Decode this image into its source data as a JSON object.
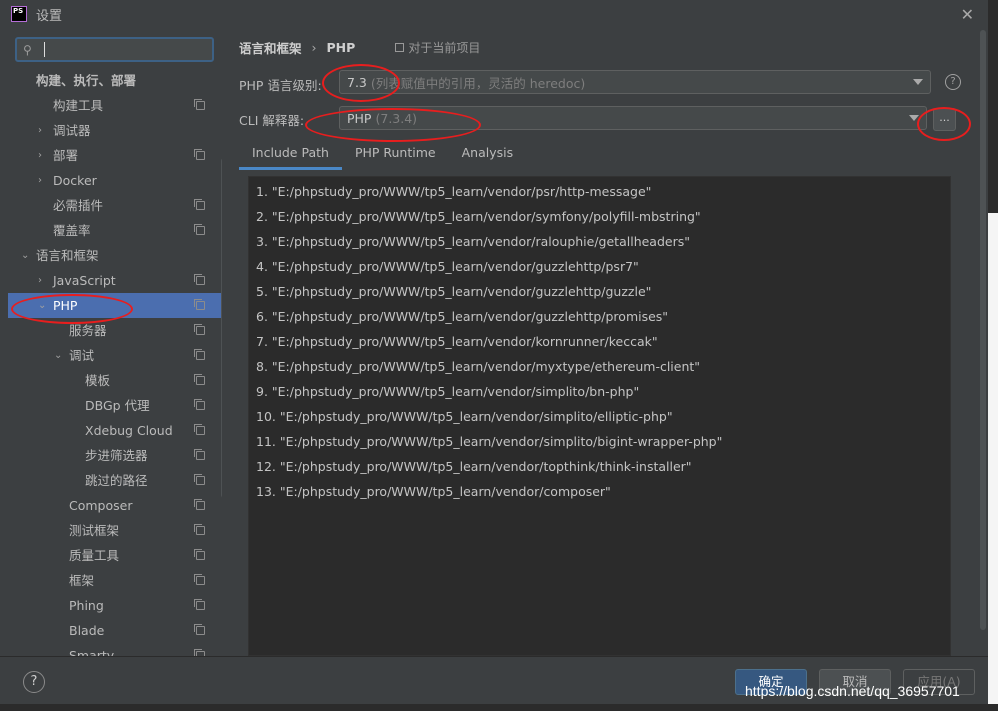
{
  "window": {
    "logo_text": "PS",
    "title": "设置",
    "close_glyph": "✕"
  },
  "search": {
    "value": ""
  },
  "tree": [
    {
      "label": "构建、执行、部署",
      "indent": 28,
      "arrow": "",
      "bold": true,
      "copy": false
    },
    {
      "label": "构建工具",
      "indent": 45,
      "arrow": "",
      "copy": true
    },
    {
      "label": "调试器",
      "indent": 45,
      "arrow": "›",
      "copy": false
    },
    {
      "label": "部署",
      "indent": 45,
      "arrow": "›",
      "copy": true
    },
    {
      "label": "Docker",
      "indent": 45,
      "arrow": "›",
      "copy": false
    },
    {
      "label": "必需插件",
      "indent": 45,
      "arrow": "",
      "copy": true
    },
    {
      "label": "覆盖率",
      "indent": 45,
      "arrow": "",
      "copy": true
    },
    {
      "label": "语言和框架",
      "indent": 28,
      "arrow": "⌄",
      "copy": false
    },
    {
      "label": "JavaScript",
      "indent": 45,
      "arrow": "›",
      "copy": true
    },
    {
      "label": "PHP",
      "indent": 45,
      "arrow": "⌄",
      "copy": true,
      "selected": true
    },
    {
      "label": "服务器",
      "indent": 61,
      "arrow": "",
      "copy": true
    },
    {
      "label": "调试",
      "indent": 61,
      "arrow": "⌄",
      "copy": true
    },
    {
      "label": "模板",
      "indent": 77,
      "arrow": "",
      "copy": true
    },
    {
      "label": "DBGp 代理",
      "indent": 77,
      "arrow": "",
      "copy": true
    },
    {
      "label": "Xdebug Cloud",
      "indent": 77,
      "arrow": "",
      "copy": true
    },
    {
      "label": "步进筛选器",
      "indent": 77,
      "arrow": "",
      "copy": true
    },
    {
      "label": "跳过的路径",
      "indent": 77,
      "arrow": "",
      "copy": true
    },
    {
      "label": "Composer",
      "indent": 61,
      "arrow": "",
      "copy": true
    },
    {
      "label": "测试框架",
      "indent": 61,
      "arrow": "",
      "copy": true
    },
    {
      "label": "质量工具",
      "indent": 61,
      "arrow": "",
      "copy": true
    },
    {
      "label": "框架",
      "indent": 61,
      "arrow": "",
      "copy": true
    },
    {
      "label": "Phing",
      "indent": 61,
      "arrow": "",
      "copy": true
    },
    {
      "label": "Blade",
      "indent": 61,
      "arrow": "",
      "copy": true
    },
    {
      "label": "Smarty",
      "indent": 61,
      "arrow": "",
      "copy": true
    }
  ],
  "breadcrumb": {
    "parent": "语言和框架",
    "separator": "›",
    "current": "PHP",
    "project_note": "对于当前项目"
  },
  "language_level": {
    "label": "PHP 语言级别:",
    "value": "7.3",
    "detail": "(列表赋值中的引用，灵活的 heredoc)"
  },
  "cli": {
    "label": "CLI 解释器:",
    "value": "PHP",
    "detail": "(7.3.4)",
    "more_label": "..."
  },
  "help_glyph": "?",
  "tabs": [
    "Include Path",
    "PHP Runtime",
    "Analysis"
  ],
  "include_paths": [
    "1. \"E:/phpstudy_pro/WWW/tp5_learn/vendor/psr/http-message\"",
    "2. \"E:/phpstudy_pro/WWW/tp5_learn/vendor/symfony/polyfill-mbstring\"",
    "3. \"E:/phpstudy_pro/WWW/tp5_learn/vendor/ralouphie/getallheaders\"",
    "4. \"E:/phpstudy_pro/WWW/tp5_learn/vendor/guzzlehttp/psr7\"",
    "5. \"E:/phpstudy_pro/WWW/tp5_learn/vendor/guzzlehttp/guzzle\"",
    "6. \"E:/phpstudy_pro/WWW/tp5_learn/vendor/guzzlehttp/promises\"",
    "7. \"E:/phpstudy_pro/WWW/tp5_learn/vendor/kornrunner/keccak\"",
    "8. \"E:/phpstudy_pro/WWW/tp5_learn/vendor/myxtype/ethereum-client\"",
    "9. \"E:/phpstudy_pro/WWW/tp5_learn/vendor/simplito/bn-php\"",
    "10. \"E:/phpstudy_pro/WWW/tp5_learn/vendor/simplito/elliptic-php\"",
    "11. \"E:/phpstudy_pro/WWW/tp5_learn/vendor/simplito/bigint-wrapper-php\"",
    "12. \"E:/phpstudy_pro/WWW/tp5_learn/vendor/topthink/think-installer\"",
    "13. \"E:/phpstudy_pro/WWW/tp5_learn/vendor/composer\""
  ],
  "buttons": {
    "help": "?",
    "ok": "确定",
    "cancel": "取消",
    "apply": "应用(A)"
  },
  "watermark": "https://blog.csdn.net/qq_36957701",
  "colors": {
    "background": "#3c3f41",
    "selection": "#4b6eaf",
    "annotation": "#e81e1e",
    "primary_button": "#365880"
  }
}
